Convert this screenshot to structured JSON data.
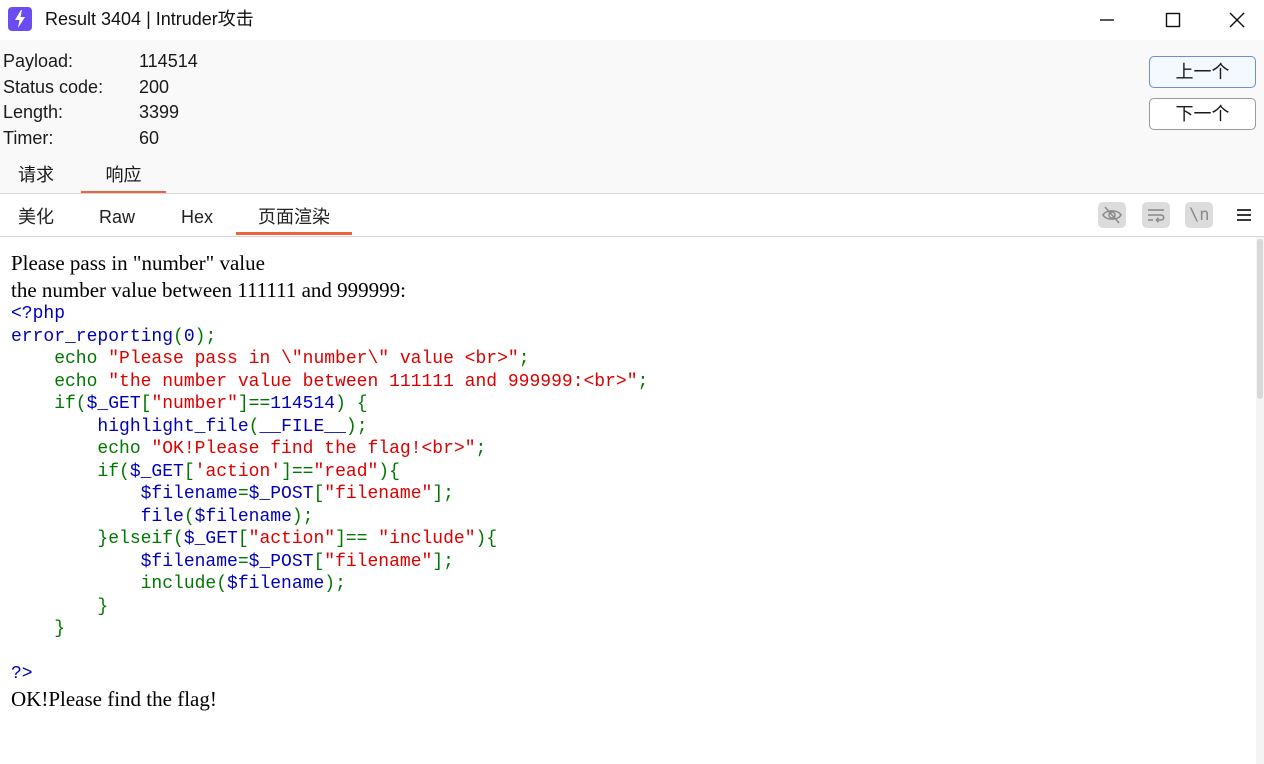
{
  "window": {
    "title": "Result 3404 | Intruder攻击",
    "icon": "burp-lightning-icon",
    "controls": [
      "minimize-icon",
      "maximize-icon",
      "close-icon"
    ]
  },
  "info": {
    "rows": [
      {
        "label": "Payload:",
        "value": "114514"
      },
      {
        "label": "Status code:",
        "value": "200"
      },
      {
        "label": "Length:",
        "value": "3399"
      },
      {
        "label": "Timer:",
        "value": "60"
      }
    ],
    "prev_label": "上一个",
    "next_label": "下一个"
  },
  "tabs": {
    "request": "请求",
    "response": "响应",
    "active": "response"
  },
  "subtabs": {
    "pretty": "美化",
    "raw": "Raw",
    "hex": "Hex",
    "render": "页面渲染",
    "active": "render",
    "toolbar_icons": [
      "hide-eye-icon",
      "word-wrap-icon",
      "newline-icon",
      "menu-icon"
    ],
    "newline_text": "\\n"
  },
  "render": {
    "line1": "Please pass in \"number\" value",
    "line2": "the number value between 111111 and 999999:",
    "code": [
      [
        {
          "t": "<?php",
          "c": "blue"
        }
      ],
      [
        {
          "t": "error_reporting",
          "c": "blue"
        },
        {
          "t": "(",
          "c": "green"
        },
        {
          "t": "0",
          "c": "blue"
        },
        {
          "t": ");",
          "c": "green"
        }
      ],
      [
        {
          "t": "    echo ",
          "c": "green"
        },
        {
          "t": "\"Please pass in \\\"number\\\" value <br>\"",
          "c": "red"
        },
        {
          "t": ";",
          "c": "green"
        }
      ],
      [
        {
          "t": "    echo ",
          "c": "green"
        },
        {
          "t": "\"the number value between 111111 and 999999:<br>\"",
          "c": "red"
        },
        {
          "t": ";",
          "c": "green"
        }
      ],
      [
        {
          "t": "    if(",
          "c": "green"
        },
        {
          "t": "$_GET",
          "c": "blue"
        },
        {
          "t": "[",
          "c": "green"
        },
        {
          "t": "\"number\"",
          "c": "red"
        },
        {
          "t": "]==",
          "c": "green"
        },
        {
          "t": "114514",
          "c": "blue"
        },
        {
          "t": ") {",
          "c": "green"
        }
      ],
      [
        {
          "t": "        ",
          "c": "green"
        },
        {
          "t": "highlight_file",
          "c": "blue"
        },
        {
          "t": "(",
          "c": "green"
        },
        {
          "t": "__FILE__",
          "c": "blue"
        },
        {
          "t": ");",
          "c": "green"
        }
      ],
      [
        {
          "t": "        echo ",
          "c": "green"
        },
        {
          "t": "\"OK!Please find the flag!<br>\"",
          "c": "red"
        },
        {
          "t": ";",
          "c": "green"
        }
      ],
      [
        {
          "t": "        if(",
          "c": "green"
        },
        {
          "t": "$_GET",
          "c": "blue"
        },
        {
          "t": "[",
          "c": "green"
        },
        {
          "t": "'action'",
          "c": "red"
        },
        {
          "t": "]==",
          "c": "green"
        },
        {
          "t": "\"read\"",
          "c": "red"
        },
        {
          "t": "){",
          "c": "green"
        }
      ],
      [
        {
          "t": "            ",
          "c": "green"
        },
        {
          "t": "$filename",
          "c": "blue"
        },
        {
          "t": "=",
          "c": "green"
        },
        {
          "t": "$_POST",
          "c": "blue"
        },
        {
          "t": "[",
          "c": "green"
        },
        {
          "t": "\"filename\"",
          "c": "red"
        },
        {
          "t": "];",
          "c": "green"
        }
      ],
      [
        {
          "t": "            ",
          "c": "green"
        },
        {
          "t": "file",
          "c": "blue"
        },
        {
          "t": "(",
          "c": "green"
        },
        {
          "t": "$filename",
          "c": "blue"
        },
        {
          "t": ");",
          "c": "green"
        }
      ],
      [
        {
          "t": "        }elseif(",
          "c": "green"
        },
        {
          "t": "$_GET",
          "c": "blue"
        },
        {
          "t": "[",
          "c": "green"
        },
        {
          "t": "\"action\"",
          "c": "red"
        },
        {
          "t": "]== ",
          "c": "green"
        },
        {
          "t": "\"include\"",
          "c": "red"
        },
        {
          "t": "){",
          "c": "green"
        }
      ],
      [
        {
          "t": "            ",
          "c": "green"
        },
        {
          "t": "$filename",
          "c": "blue"
        },
        {
          "t": "=",
          "c": "green"
        },
        {
          "t": "$_POST",
          "c": "blue"
        },
        {
          "t": "[",
          "c": "green"
        },
        {
          "t": "\"filename\"",
          "c": "red"
        },
        {
          "t": "];",
          "c": "green"
        }
      ],
      [
        {
          "t": "            include(",
          "c": "green"
        },
        {
          "t": "$filename",
          "c": "blue"
        },
        {
          "t": ");",
          "c": "green"
        }
      ],
      [
        {
          "t": "        }",
          "c": "green"
        }
      ],
      [
        {
          "t": "    }",
          "c": "green"
        }
      ],
      [
        {
          "t": "",
          "c": "green"
        }
      ],
      [
        {
          "t": "?>",
          "c": "blue"
        }
      ]
    ],
    "line3": "OK!Please find the flag!"
  },
  "colors": {
    "accent": "#e8673a",
    "code_blue": "#0000bb",
    "code_green": "#007700",
    "code_red": "#dd0000",
    "icon_purple": "#6a4cf0"
  }
}
